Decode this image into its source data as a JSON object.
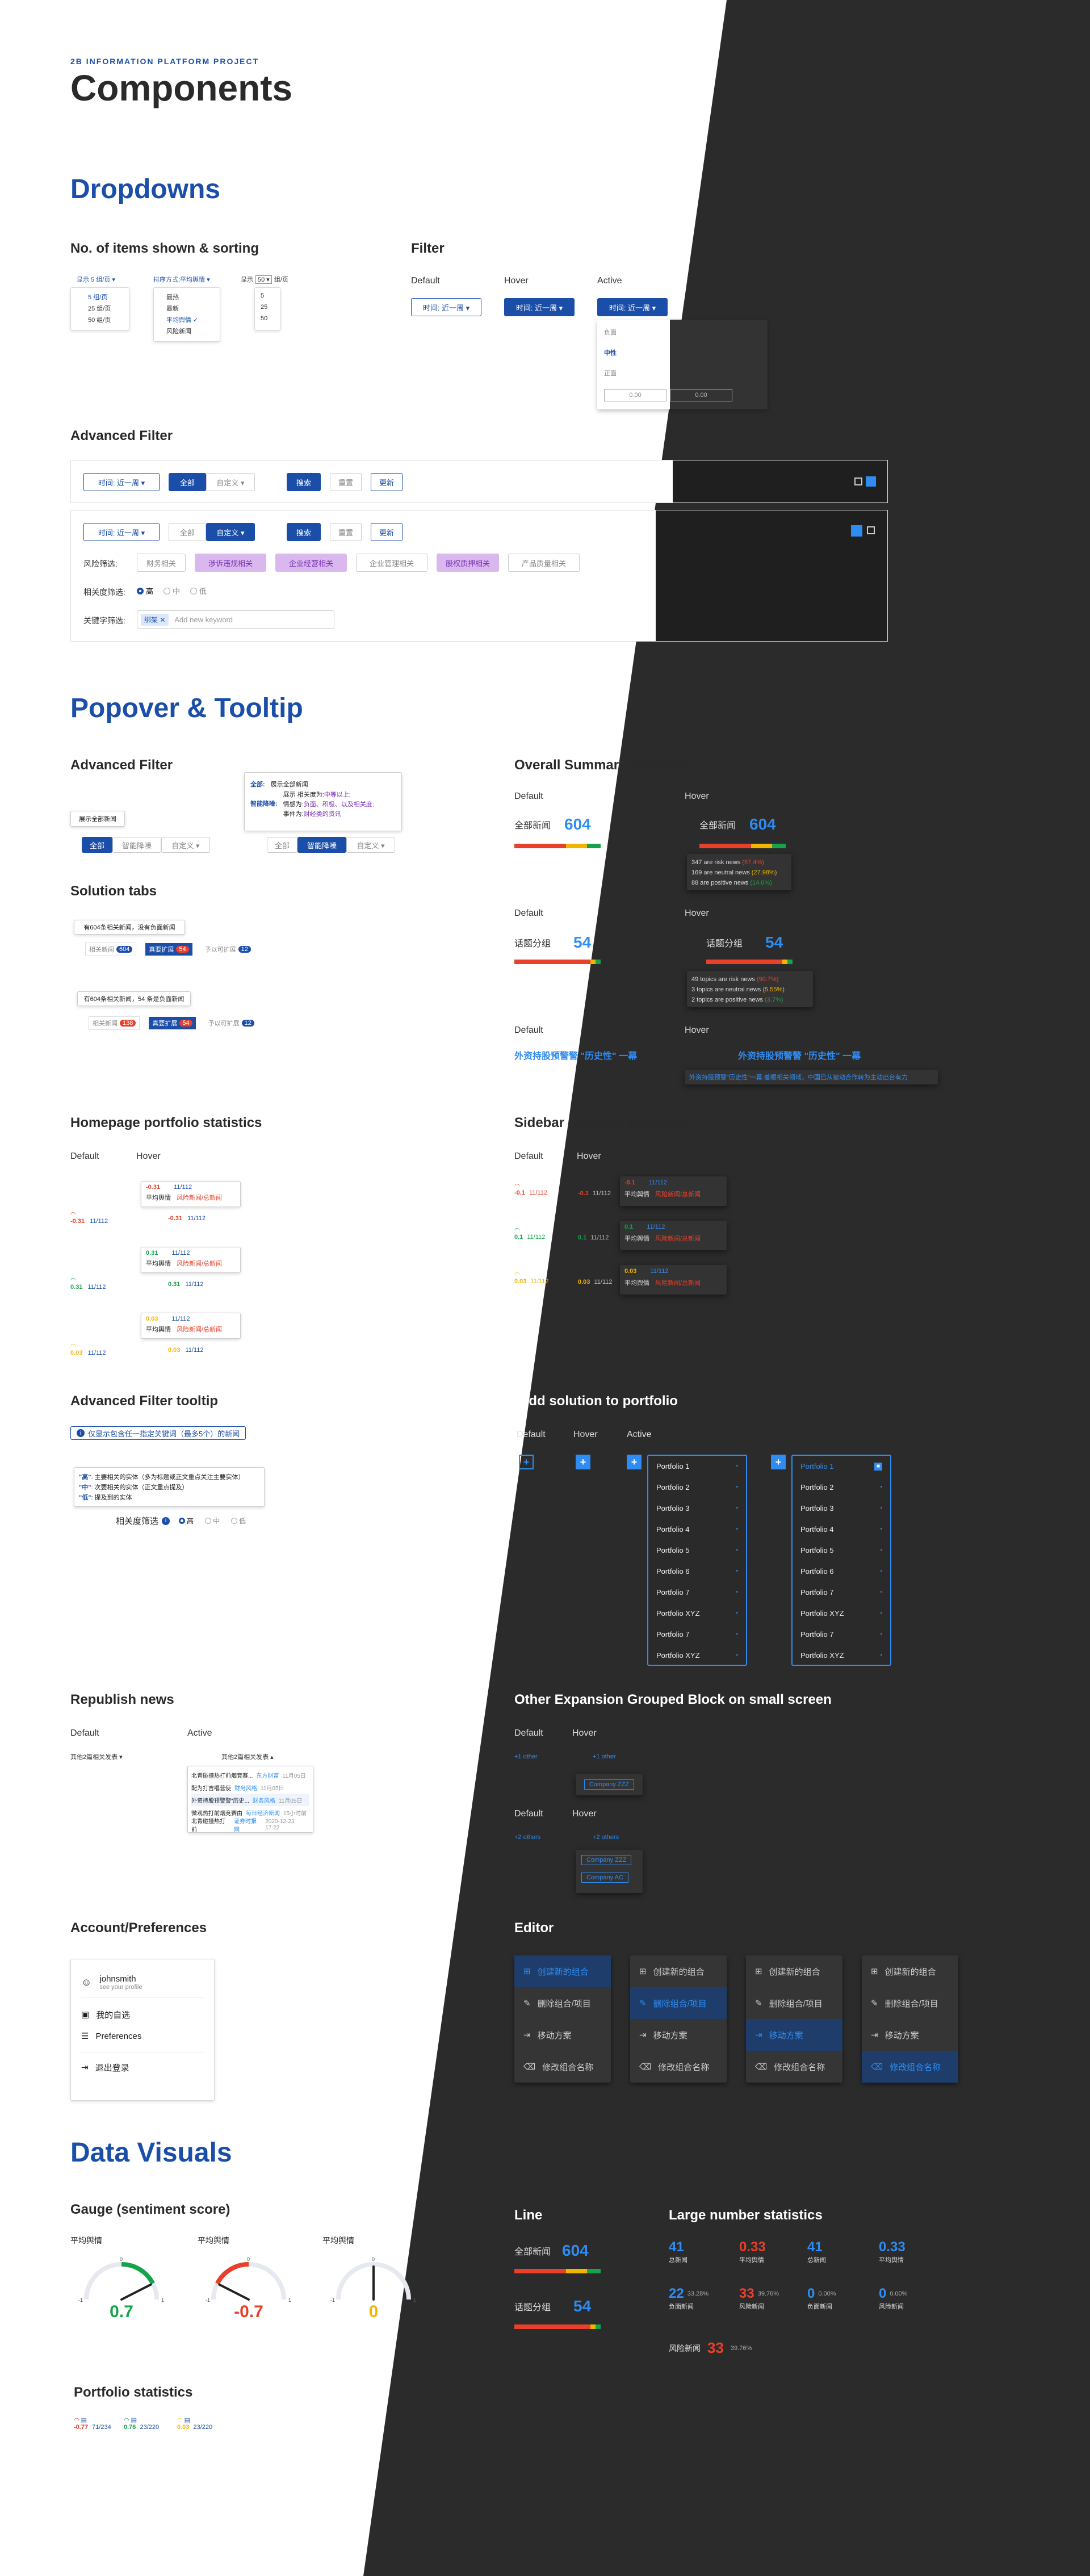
{
  "header": {
    "project": "2B INFORMATION PLATFORM PROJECT",
    "title": "Components"
  },
  "sections": {
    "dropdowns": "Dropdowns",
    "popover": "Popover & Tooltip",
    "datavisuals": "Data Visuals"
  },
  "dropdowns": {
    "items_title": "No. of items shown & sorting",
    "show_label": "显示 5 组/页 ▾",
    "show_options": [
      "5 组/页",
      "25 组/页",
      "50 组/页"
    ],
    "sort_label": "排序方式:平均舆情 ▾",
    "sort_options": [
      "最热",
      "最新",
      "平均舆情 ✓",
      "风险新闻"
    ],
    "pager_label": "显示",
    "pager_value": "50 ▾",
    "pager_unit": "组/页",
    "pager_options": [
      "5",
      "25",
      "50"
    ],
    "filter_title": "Filter",
    "default": "Default",
    "hover": "Hover",
    "active": "Active",
    "filter_value": "时间: 近一周 ▾",
    "filter_options": [
      "负面",
      "中性",
      "正面"
    ],
    "range_from": "0.00",
    "range_to": "0.00"
  },
  "advanced_filter": {
    "title": "Advanced Filter",
    "time": "时间: 近一周 ▾",
    "all": "全部",
    "custom": "自定义 ▾",
    "search": "搜索",
    "reset": "重置",
    "update": "更新",
    "risk_label": "风险筛选:",
    "risk_chips": [
      "财务相关",
      "涉诉违规相关",
      "企业经营相关",
      "企业管理相关",
      "股权质押相关",
      "产品质量相关"
    ],
    "rel_label": "相关度筛选:",
    "rel_opts": [
      "高",
      "中",
      "低"
    ],
    "kw_label": "关键字筛选:",
    "kw_tag": "绑架 ✕",
    "kw_placeholder": "Add new keyword"
  },
  "popover": {
    "adv_title": "Advanced Filter",
    "show_all": "展示全部新闻",
    "all": "全部",
    "smart": "智能降噪",
    "custom": "自定义 ▾",
    "pop_all": "全部:",
    "pop_all_desc": "展示全部新闻",
    "pop_smart": "智能降噪:",
    "pop_smart_l1": "展示 相关度为:",
    "pop_smart_v1": "中等以上;",
    "pop_smart_l2": "情感为:",
    "pop_smart_v2": "负面、积极、以及相关度;",
    "pop_smart_l3": "事件为:",
    "pop_smart_v3": "财经类的资讯",
    "sol_title": "Solution tabs",
    "sol_tip1": "有604条相关新闻，没有负面新闻",
    "sol_tip2": "有604条相关新闻，54 条是负面新闻",
    "sol_tab_a": "相关新闻",
    "sol_tab_a_count": "604",
    "sol_tab_b": "真要扩展",
    "sol_tab_b_count": "54",
    "sol_tab_c": "予以可扩展",
    "sol_tab_c_count": "12",
    "sol_tab_a2_count": "138",
    "sol_tab_b2_count": "54",
    "sol_tab_c2_count": "12",
    "oss_title": "Overall Summary Statistics",
    "default": "Default",
    "hover": "Hover",
    "all_news": "全部新闻",
    "all_news_val": "604",
    "risk_l": "347 are risk news",
    "risk_p": "(57.4%)",
    "neu_l": "169 are neutral news",
    "neu_p": "(27.98%)",
    "pos_l": "88 are positive news",
    "pos_p": "(14.6%)",
    "topic": "话题分组",
    "topic_val": "54",
    "t_risk": "49 topics are risk news",
    "t_risk_p": "(90.7%)",
    "t_neu": "3 topics are neutral news",
    "t_neu_p": "(5.55%)",
    "t_pos": "2 topics are positive news",
    "t_pos_p": "(3.7%)",
    "link_text": "外资持股预警警 \"历史性\" 一幕",
    "link_tip": "外资持股预警\"历史性\"一幕:着眼相关领域，中国已从被动合作转为主动出台有力"
  },
  "homepage_stats": {
    "title": "Homepage portfolio statistics",
    "default": "Default",
    "hover": "Hover",
    "rows": [
      {
        "val": "-0.31",
        "cnt": "11/112",
        "cls": "red"
      },
      {
        "val": "0.31",
        "cnt": "11/112",
        "cls": "green"
      },
      {
        "val": "0.03",
        "cnt": "11/112",
        "cls": "yellow"
      }
    ],
    "avg": "平均舆情",
    "riskd": "风险新闻/总新闻"
  },
  "sidebar_stats": {
    "title": "Sidebar portfolio statistics",
    "default": "Default",
    "hover": "Hover",
    "rows": [
      {
        "val": "-0.1",
        "cnt": "11/112",
        "cls": "red"
      },
      {
        "val": "0.1",
        "cnt": "11/112",
        "cls": "green"
      },
      {
        "val": "0.03",
        "cnt": "11/112",
        "cls": "yellow"
      }
    ],
    "avg": "平均舆情",
    "riskd": "风险新闻/总新闻"
  },
  "adv_tooltip": {
    "title": "Advanced Filter tooltip",
    "hint": "仅显示包含任一指定关键词（最多5个）的新闻",
    "l1k": "\"高\"",
    "l1": ": 主要相关的实体（多为标题或正文重点关注主要实体）",
    "l2k": "\"中\"",
    "l2": ": 次要相关的实体（正文重点提及）",
    "l3k": "\"低\"",
    "l3": ": 提及到的实体",
    "rel_label": "相关度筛选",
    "opts": [
      "高",
      "中",
      "低"
    ]
  },
  "add_solution": {
    "title": "Add solution to portfolio",
    "default": "Default",
    "hover": "Hover",
    "active": "Active",
    "items": [
      "Portfolio 1",
      "Portfolio 2",
      "Portfolio 3",
      "Portfolio 4",
      "Portfolio 5",
      "Portfolio 6",
      "Portfolio 7",
      "Portfolio XYZ",
      "Portfolio 7",
      "Portfolio XYZ"
    ]
  },
  "republish": {
    "title": "Republish news",
    "default": "Default",
    "active": "Active",
    "label": "其他2篇相关发表 ▾",
    "label_active": "其他2篇相关发表 ▴",
    "rows": [
      {
        "t": "北青碰撞热打前烟竞赛...",
        "s": "东方财富",
        "d": "11月05日"
      },
      {
        "t": "配为打吉唱营使",
        "s": "财务风格",
        "d": "11月05日"
      },
      {
        "t": "外资持股预警警\"历史...",
        "s": "财务风格",
        "d": "11月05日"
      },
      {
        "t": "微观热打前烟竞赛由",
        "s": "每日经济新闻",
        "d": "15小时前"
      },
      {
        "t": "北青碰撞热打前",
        "s": "证券时报网",
        "d": "2020-12-23 17:22"
      }
    ]
  },
  "other_block": {
    "title": "Other Expansion Grouped Block on small screen",
    "default": "Default",
    "hover": "Hover",
    "more1": "+1 other",
    "comp1": "Company ZZZ",
    "more2": "+2 others",
    "comp2": "Company ZZZ",
    "comp3": "Company AC"
  },
  "account": {
    "title": "Account/Preferences",
    "user": "johnsmith",
    "see": "see your profile",
    "items": [
      "我的自选",
      "Preferences",
      "退出登录"
    ]
  },
  "editor": {
    "title": "Editor",
    "items": [
      "创建新的组合",
      "删除组合/项目",
      "移动方案",
      "修改组合名称"
    ]
  },
  "gauges": {
    "title": "Gauge (sentiment score)",
    "label": "平均舆情",
    "items": [
      {
        "val": "0.7",
        "cls": "green",
        "num": 0.7
      },
      {
        "val": "-0.7",
        "cls": "red",
        "num": -0.7
      },
      {
        "val": "0",
        "cls": "yellow",
        "num": 0
      }
    ],
    "min": "-1",
    "max": "1",
    "mid": "0"
  },
  "portfolio_stats": {
    "title": "Portfolio statistics",
    "items": [
      {
        "v": "-0.77",
        "c": "71/234",
        "cls": "red"
      },
      {
        "v": "0.76",
        "c": "23/220",
        "cls": "green"
      },
      {
        "v": "0.03",
        "c": "23/220",
        "cls": "yellow"
      }
    ]
  },
  "line": {
    "title": "Line",
    "all": "全部新闻",
    "all_val": "604",
    "topic": "话题分组",
    "topic_val": "54"
  },
  "large": {
    "title": "Large number statistics",
    "r1": [
      {
        "v": "41",
        "l": "总新闻",
        "cls": "blue"
      },
      {
        "v": "0.33",
        "l": "平均舆情",
        "cls": "red"
      },
      {
        "v": "41",
        "l": "总新闻",
        "cls": "blue"
      },
      {
        "v": "0.33",
        "l": "平均舆情",
        "cls": "blue"
      }
    ],
    "r2": [
      {
        "v": "22",
        "p": "33.28%",
        "l": "负面新闻",
        "cls": "blue"
      },
      {
        "v": "33",
        "p": "39.76%",
        "l": "风险新闻",
        "cls": "red"
      },
      {
        "v": "0",
        "p": "0.00%",
        "l": "负面新闻",
        "cls": "blue"
      },
      {
        "v": "0",
        "p": "0.00%",
        "l": "风险新闻",
        "cls": "blue"
      }
    ],
    "r3": {
      "l": "风险新闻",
      "v": "33",
      "p": "39.76%"
    }
  },
  "colors": {
    "blue": "#1a4ea8",
    "accent": "#2f8cf2",
    "red": "#e8402a",
    "green": "#16a34a",
    "yellow": "#f2b600",
    "dark": "#2b2b2b"
  }
}
